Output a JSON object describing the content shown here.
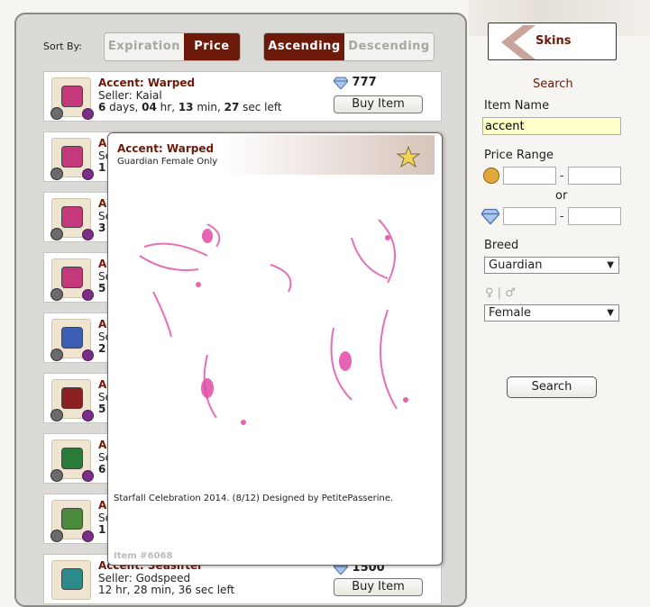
{
  "sort": {
    "label": "Sort By:",
    "field_options": [
      "Expiration",
      "Price"
    ],
    "field_selected": "Price",
    "order_options": [
      "Ascending",
      "Descending"
    ],
    "order_selected": "Ascending"
  },
  "listings": [
    {
      "name": "Accent: Warped",
      "seller": "Seller: Kaial",
      "time": {
        "days": "6",
        "hr": "04",
        "min": "13",
        "sec": "27",
        "d_lbl": " days, ",
        "h_lbl": " hr, ",
        "m_lbl": " min, ",
        "s_lbl": " sec left"
      },
      "price": "777",
      "buy_label": "Buy Item",
      "gem_color": "#c4397c"
    },
    {
      "name_stub": "Ac",
      "seller_stub": "Se",
      "time_stub": "1",
      "gem_color": "#c4397c"
    },
    {
      "name_stub": "Ac",
      "seller_stub": "Se",
      "time_stub": "3",
      "gem_color": "#c4397c"
    },
    {
      "name_stub": "Ac",
      "seller_stub": "Se",
      "time_stub": "5",
      "gem_color": "#c4397c"
    },
    {
      "name_stub": "Ac",
      "seller_stub": "Se",
      "time_stub": "2",
      "gem_color": "#3a5fb5"
    },
    {
      "name_stub": "Ac",
      "seller_stub": "Se",
      "time_stub": "5",
      "gem_color": "#8a2020"
    },
    {
      "name_stub": "Ac",
      "seller_stub": "Se",
      "time_stub": "6",
      "gem_color": "#2a7a3a"
    },
    {
      "name_stub": "Ac",
      "seller_stub": "Se",
      "time_stub": "1",
      "gem_color": "#4a8a3a"
    },
    {
      "name": "Accent: Seasifter",
      "seller": "Seller: Godspeed",
      "time_text": "12 hr, 28 min, 36 sec left",
      "price": "1500",
      "buy_label": "Buy Item",
      "gem_color": "#2c8a8a"
    }
  ],
  "popup": {
    "title": "Accent: Warped",
    "subtitle": "Guardian Female Only",
    "description": "Starfall Celebration 2014. (8/12) Designed by PetitePasserine.",
    "item_id": "Item #6068",
    "accent_color": "#e24aa6"
  },
  "sidebar": {
    "skins_label": "Skins",
    "search_title": "Search",
    "item_name_label": "Item Name",
    "item_name_value": "accent",
    "price_range_label": "Price Range",
    "or_label": "or",
    "dash": "-",
    "breed_label": "Breed",
    "breed_value": "Guardian",
    "gender_symbols": "♀ | ♂",
    "gender_value": "Female",
    "search_button": "Search"
  },
  "colors": {
    "brand": "#6d1a0a",
    "highlight_field": "#ffffc8"
  }
}
